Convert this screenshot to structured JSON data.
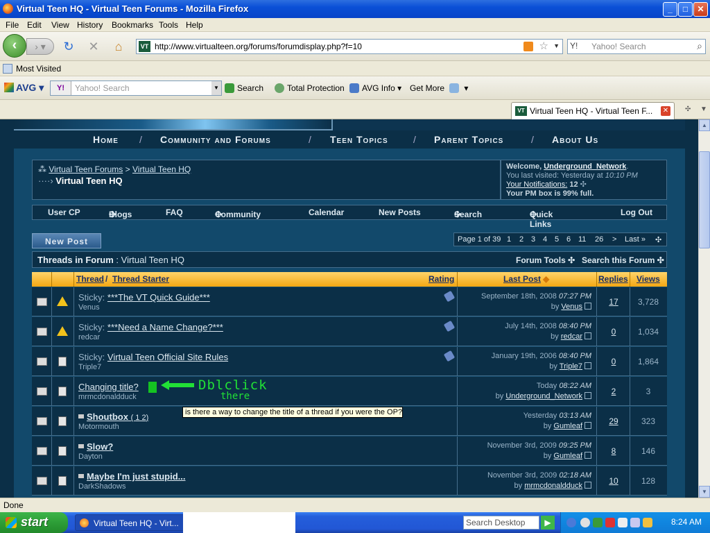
{
  "window": {
    "title": "Virtual Teen HQ - Virtual Teen Forums - Mozilla Firefox",
    "min": "_",
    "max": "□",
    "close": "✕"
  },
  "menu": [
    "File",
    "Edit",
    "View",
    "History",
    "Bookmarks",
    "Tools",
    "Help"
  ],
  "nav": {
    "url": "http://www.virtualteen.org/forums/forumdisplay.php?f=10",
    "favicon": "VT",
    "search_engine": "Y!",
    "search_placeholder": "Yahoo! Search"
  },
  "bookmarks": {
    "most_visited": "Most Visited"
  },
  "avg": {
    "logo": "AVG",
    "yahoo_badge": "Y!",
    "search_placeholder": "Yahoo! Search",
    "search": "Search",
    "total_protection": "Total Protection",
    "avg_info": "AVG Info",
    "get_more": "Get More"
  },
  "tab": {
    "title": "Virtual Teen HQ - Virtual Teen F...",
    "favicon": "VT"
  },
  "site_nav": {
    "home": "Home",
    "community": "Community and Forums",
    "teen": "Teen Topics",
    "parent": "Parent Topics",
    "about": "About Us",
    "sep": "/"
  },
  "breadcrumb": {
    "root": "Virtual Teen Forums",
    "parent": "Virtual Teen HQ",
    "current": "Virtual Teen HQ"
  },
  "welcome": {
    "prefix": "Welcome,",
    "user": "Underground_Network",
    "last_visit_label": "You last visited: Yesterday at",
    "last_visit_time": "10:10 PM",
    "notifications_label": "Your Notifications:",
    "notifications_count": "12",
    "pm": "Your PM box is 99% full."
  },
  "toolnav": [
    "User CP",
    "Blogs",
    "FAQ",
    "Community",
    "Calendar",
    "New Posts",
    "Search",
    "Quick Links",
    "Log Out"
  ],
  "new_post": "New Post",
  "pager": {
    "label": "Page 1 of 39",
    "pages": [
      "1",
      "2",
      "3",
      "4",
      "5",
      "6",
      "11",
      "26",
      ">",
      "Last »"
    ]
  },
  "forum_head": {
    "label": "Threads in Forum",
    "forum": "Virtual Teen HQ",
    "tools": "Forum Tools",
    "search": "Search this Forum"
  },
  "columns": {
    "thread": "Thread",
    "starter": "Thread Starter",
    "rating": "Rating",
    "last_post": "Last Post",
    "replies": "Replies",
    "views": "Views"
  },
  "threads": [
    {
      "prefix": "Sticky:",
      "title": "***The VT Quick Guide***",
      "starter": "Venus",
      "date": "September 18th, 2008",
      "time": "07:27 PM",
      "by": "Venus",
      "replies": "17",
      "views": "3,728"
    },
    {
      "prefix": "Sticky:",
      "title": "***Need a Name Change?***",
      "starter": "redcar",
      "date": "July 14th, 2008",
      "time": "08:40 PM",
      "by": "redcar",
      "replies": "0",
      "views": "1,034"
    },
    {
      "prefix": "Sticky:",
      "title": "Virtual Teen Official Site Rules",
      "starter": "Triple7",
      "date": "January 19th, 2006",
      "time": "08:40 PM",
      "by": "Triple7",
      "replies": "0",
      "views": "1,864"
    },
    {
      "prefix": "",
      "title": "Changing title?",
      "starter": "mrmcdonaldduck",
      "date": "Today",
      "time": "08:22 AM",
      "by": "Underground_Network",
      "replies": "2",
      "views": "3"
    },
    {
      "prefix": "",
      "title": "Shoutbox",
      "pages": [
        "1",
        "2"
      ],
      "starter": "Motormouth",
      "date": "Yesterday",
      "time": "03:13 AM",
      "by": "Gumleaf",
      "replies": "29",
      "views": "323"
    },
    {
      "prefix": "",
      "title": "Slow?",
      "starter": "Dayton",
      "date": "November 3rd, 2009",
      "time": "09:25 PM",
      "by": "Gumleaf",
      "replies": "8",
      "views": "146"
    },
    {
      "prefix": "",
      "title": "Maybe I'm just stupid...",
      "starter": "DarkShadows",
      "date": "November 3rd, 2009",
      "time": "02:18 AM",
      "by": "mrmcdonaldduck",
      "replies": "10",
      "views": "128"
    }
  ],
  "by_label": "by",
  "annotation": {
    "line1": "Dblclick",
    "line2": "there"
  },
  "tooltip": "is there a way to change the title of a thread if you were the OP?",
  "status": "Done",
  "taskbar": {
    "start": "start",
    "item": "Virtual Teen HQ - Virt...",
    "desktop_search": "Search Desktop",
    "clock": "8:24 AM"
  }
}
